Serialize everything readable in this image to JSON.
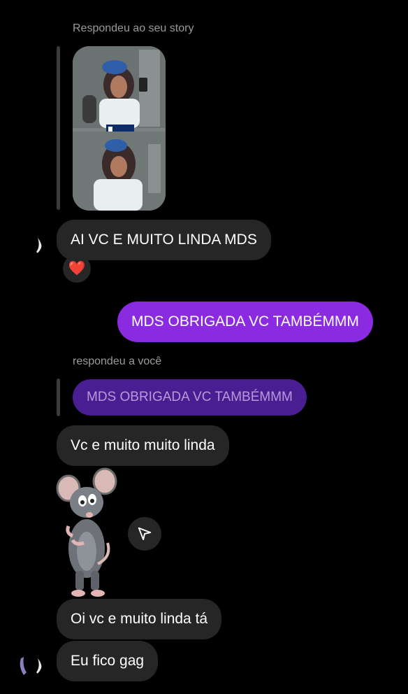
{
  "story_reply": {
    "caption": "Respondeu ao seu story"
  },
  "messages": {
    "m1": "AI VC E MUITO LINDA MDS",
    "m1_reaction": "❤️",
    "m2_sent": "MDS OBRIGADA VC TAMBÉMMM",
    "reply_caption": "respondeu a você",
    "quoted": "MDS OBRIGADA VC TAMBÉMMM",
    "m3": "Vc e muito muito linda",
    "m4": "Oi vc e muito linda tá",
    "m5": "Eu fico gag"
  },
  "icons": {
    "share": "send-arrow-icon",
    "heart": "heart-icon",
    "sticker": "mouse-sticker"
  },
  "colors": {
    "sent_bubble": "#8a2be2",
    "received_bubble": "#262626",
    "quoted_bubble": "#4a1d92",
    "background": "#000000"
  }
}
